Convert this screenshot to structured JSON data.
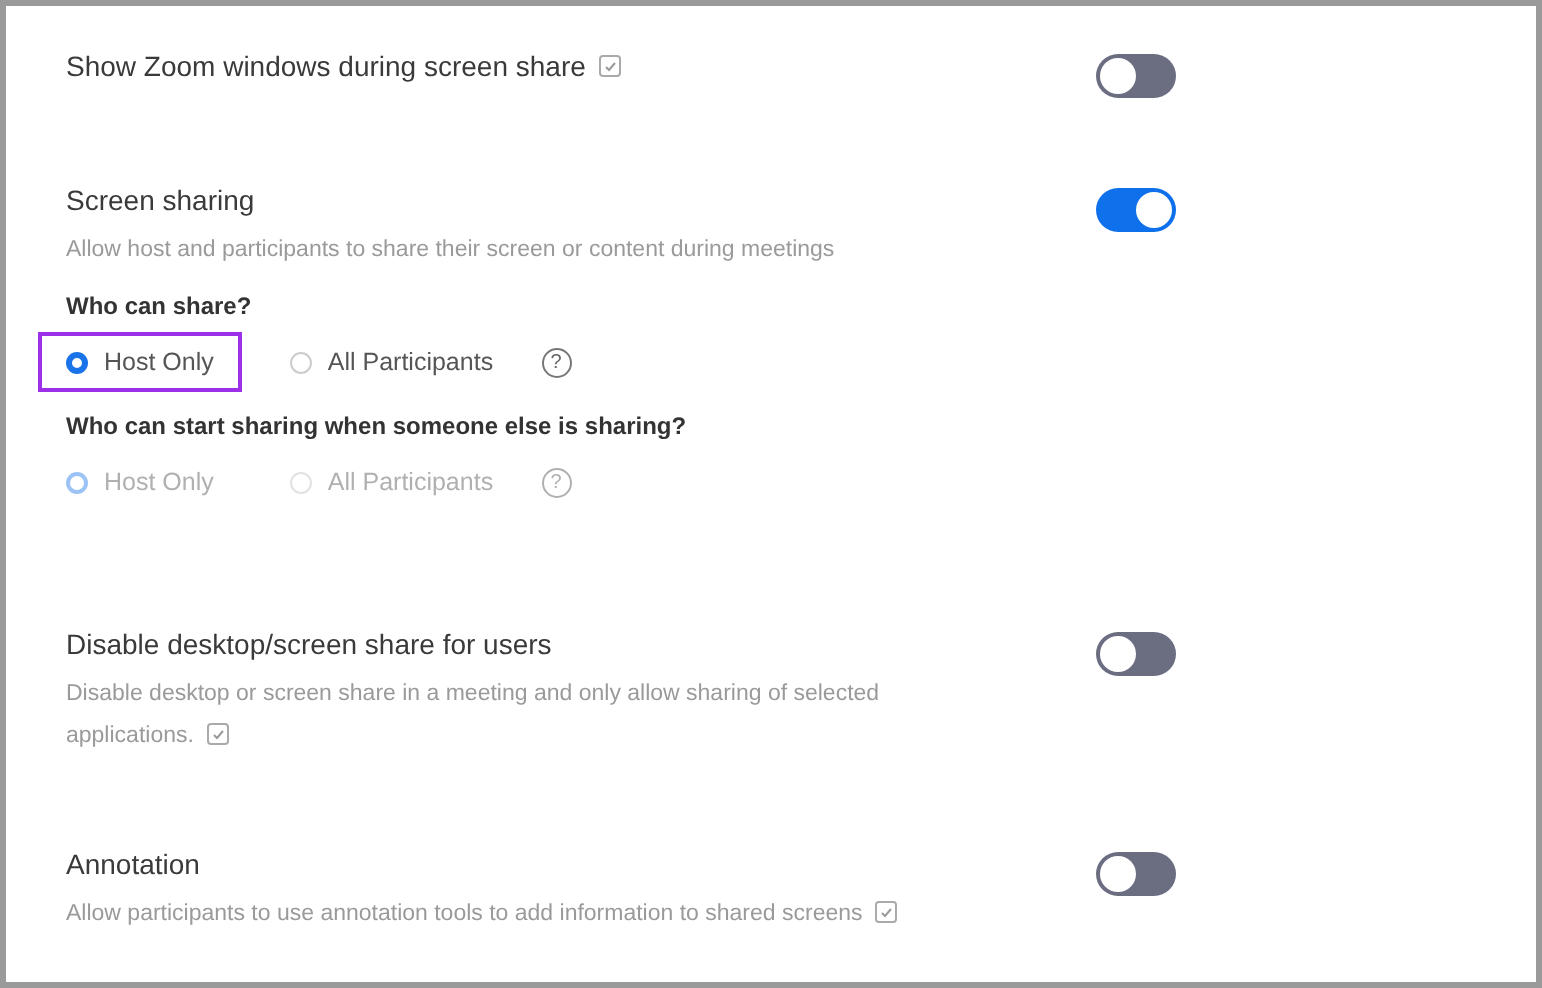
{
  "settings": [
    {
      "title": "Show Zoom windows during screen share",
      "title_info": true,
      "on": false
    },
    {
      "title": "Screen sharing",
      "description": "Allow host and participants to share their screen or content during meetings",
      "on": true,
      "groups": [
        {
          "question": "Who can share?",
          "disabled": false,
          "options": [
            {
              "label": "Host Only",
              "selected": true,
              "highlighted": true
            },
            {
              "label": "All Participants",
              "selected": false,
              "highlighted": false
            }
          ],
          "help": "?"
        },
        {
          "question": "Who can start sharing when someone else is sharing?",
          "disabled": true,
          "options": [
            {
              "label": "Host Only",
              "selected": true,
              "highlighted": false
            },
            {
              "label": "All Participants",
              "selected": false,
              "highlighted": false
            }
          ],
          "help": "?"
        }
      ]
    },
    {
      "title": "Disable desktop/screen share for users",
      "description": "Disable desktop or screen share in a meeting and only allow sharing of selected applications.",
      "description_info": true,
      "on": false
    },
    {
      "title": "Annotation",
      "description": "Allow participants to use annotation tools to add information to shared screens",
      "description_info": true,
      "on": false
    }
  ]
}
